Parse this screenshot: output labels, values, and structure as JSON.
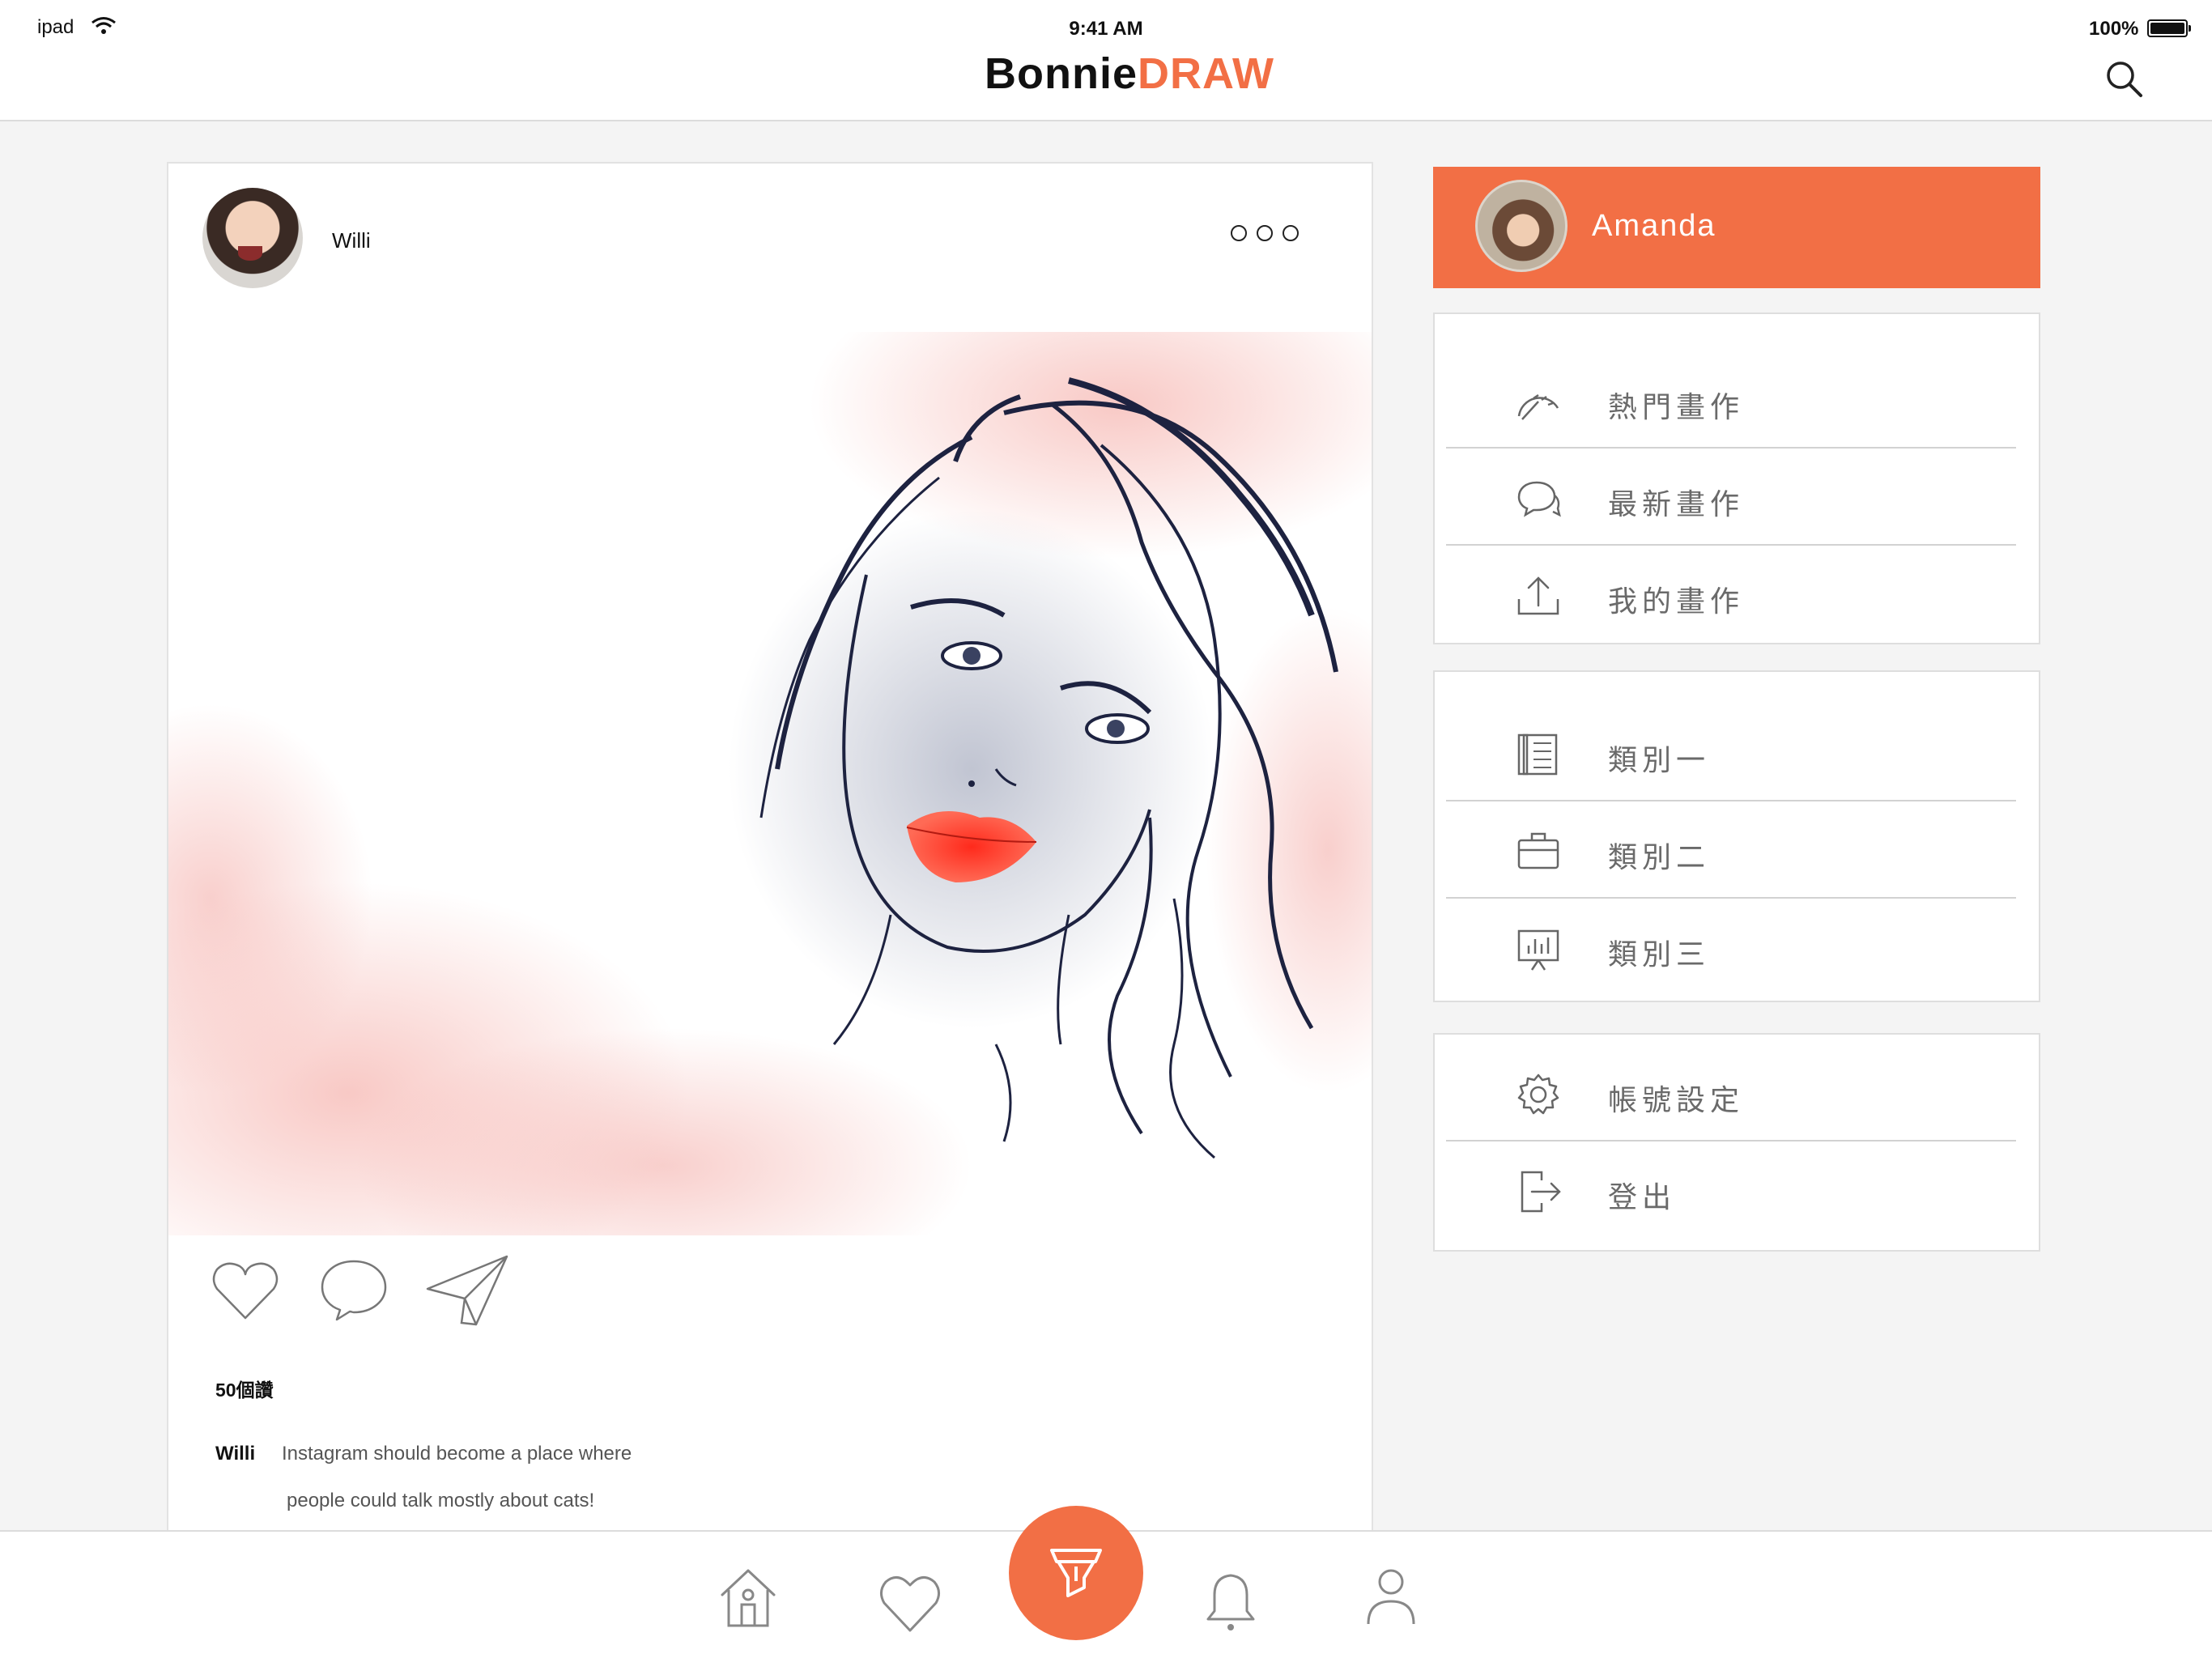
{
  "status_bar": {
    "device": "ipad",
    "time": "9:41 AM",
    "battery": "100%"
  },
  "nav": {
    "brand_part1": "Bonnie",
    "brand_part2": "DRAW",
    "brand_color": "#f26f45",
    "search_icon": "search-icon"
  },
  "post": {
    "author": "Willi",
    "more_icon": "more-dots-icon",
    "likes": "50個讚",
    "caption_user": "Willi",
    "caption_line1": "Instagram should become a place where",
    "caption_line2": "people could talk mostly about cats!",
    "actions": [
      "heart-icon",
      "comment-icon",
      "share-paper-plane-icon"
    ]
  },
  "profile": {
    "name": "Amanda",
    "background": "#f26f45"
  },
  "menu_groups": [
    {
      "items": [
        {
          "label": "熱門畫作",
          "icon": "trending-gauge-icon"
        },
        {
          "label": "最新畫作",
          "icon": "chat-bubbles-icon"
        },
        {
          "label": "我的畫作",
          "icon": "upload-icon"
        }
      ]
    },
    {
      "items": [
        {
          "label": "類別一",
          "icon": "notebook-icon"
        },
        {
          "label": "類別二",
          "icon": "briefcase-icon"
        },
        {
          "label": "類別三",
          "icon": "presentation-board-icon"
        }
      ]
    },
    {
      "items": [
        {
          "label": "帳號設定",
          "icon": "gear-icon"
        },
        {
          "label": "登出",
          "icon": "logout-icon"
        }
      ]
    }
  ],
  "tabbar": {
    "items": [
      "home-icon",
      "heart-icon",
      "draw-brush-icon",
      "bell-icon",
      "user-icon"
    ],
    "active": "draw-brush-icon"
  }
}
